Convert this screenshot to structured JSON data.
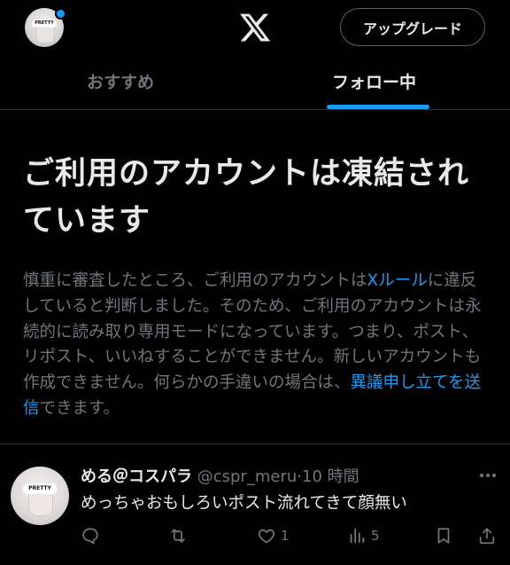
{
  "header": {
    "avatar_badge": "PRETTY",
    "upgrade_label": "アップグレード",
    "tabs": [
      {
        "label": "おすすめ",
        "selected": false
      },
      {
        "label": "フォロー中",
        "selected": true
      }
    ],
    "logo_icon": "x-logo-icon"
  },
  "notice": {
    "title": "ご利用のアカウントは凍結されています",
    "body_1": "慎重に審査したところ、ご利用のアカウントは",
    "rules_link": "Xルール",
    "body_2": "に違反していると判断しました。そのため、ご利用のアカウントは永続的に読み取り専用モードになっています。つまり、ポスト、リポスト、いいねすることができません。新しいアカウントも作成できません。何らかの手違いの場合は、",
    "appeal_link": "異議申し立てを送信",
    "body_3": "できます。"
  },
  "post": {
    "avatar_badge": "PRETTY",
    "display_name": "める＠コスパラ",
    "handle": "@cspr_meru",
    "separator": "·",
    "time": "10 時間",
    "text": "めっちゃおもしろいポスト流れてきて顔無い",
    "actions": {
      "reply_icon": "reply-icon",
      "repost_icon": "repost-icon",
      "like_icon": "heart-icon",
      "like_count": "1",
      "views_icon": "views-icon",
      "views_count": "5",
      "bookmark_icon": "bookmark-icon",
      "share_icon": "share-icon"
    }
  },
  "colors": {
    "background": "#000000",
    "accent": "#1d9bf0",
    "primary_text": "#e7e9ea",
    "secondary_text": "#71767b",
    "border": "#2f3336"
  }
}
